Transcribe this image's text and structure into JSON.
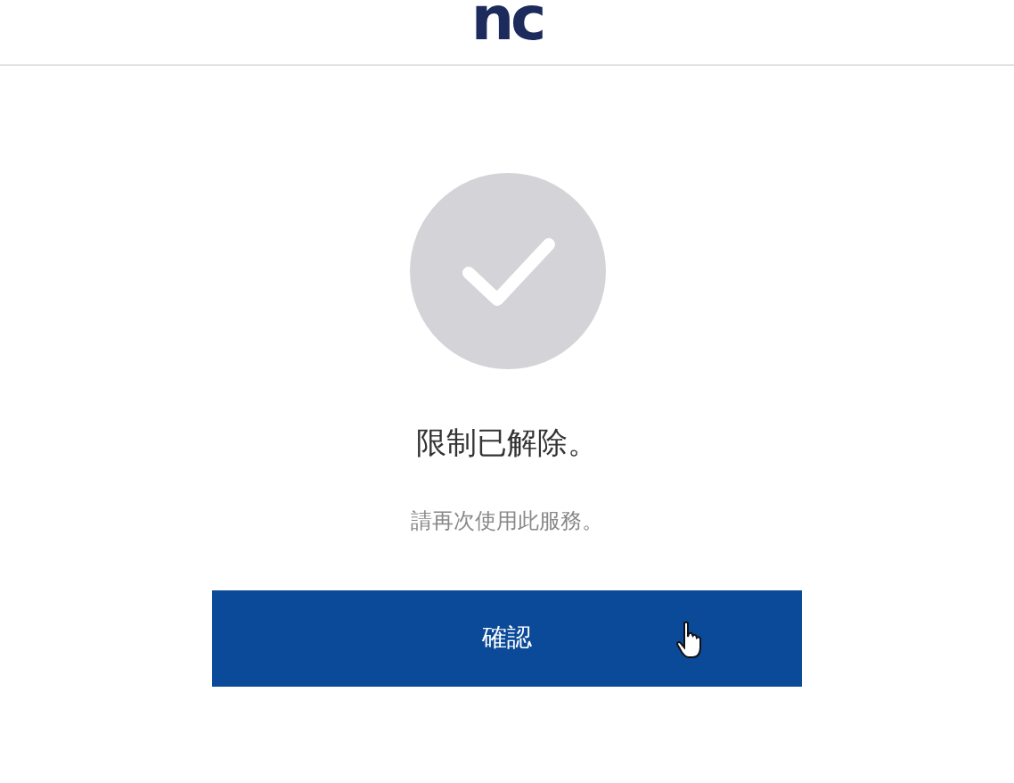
{
  "header": {
    "logo": "nc"
  },
  "status": {
    "kind": "success",
    "title": "限制已解除。",
    "message": "請再次使用此服務。"
  },
  "button": {
    "label": "確認"
  }
}
